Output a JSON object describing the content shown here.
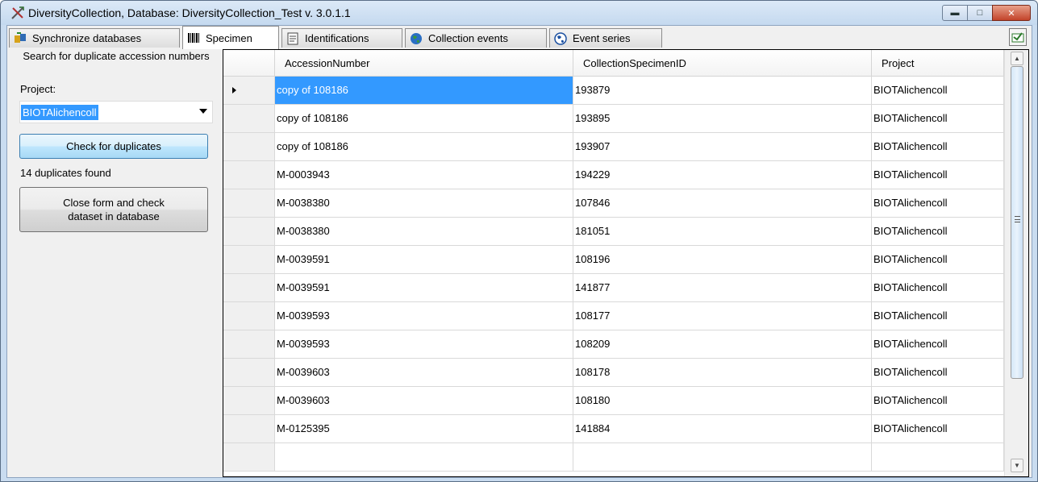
{
  "window": {
    "title": "DiversityCollection,  Database: DiversityCollection_Test   v. 3.0.1.1"
  },
  "tabs": [
    {
      "label": "Synchronize databases",
      "icon": "sync-databases-icon"
    },
    {
      "label": "Specimen",
      "icon": "barcode-icon",
      "active": true
    },
    {
      "label": "Identifications",
      "icon": "list-icon"
    },
    {
      "label": "Collection events",
      "icon": "globe-icon"
    },
    {
      "label": "Event series",
      "icon": "globe-series-icon"
    }
  ],
  "panel": {
    "search_title": "Search for duplicate accession numbers",
    "project_label": "Project:",
    "project_value": "BIOTAlichencoll",
    "check_button": "Check for duplicates",
    "result_text": "14 duplicates found",
    "close_button_line1": "Close form and check",
    "close_button_line2": "dataset in database"
  },
  "grid": {
    "columns": [
      "AccessionNumber",
      "CollectionSpecimenID",
      "Project"
    ],
    "rows": [
      [
        "copy of 108186",
        "193879",
        "BIOTAlichencoll"
      ],
      [
        "copy of 108186",
        "193895",
        "BIOTAlichencoll"
      ],
      [
        "copy of 108186",
        "193907",
        "BIOTAlichencoll"
      ],
      [
        "M-0003943",
        "194229",
        "BIOTAlichencoll"
      ],
      [
        "M-0038380",
        "107846",
        "BIOTAlichencoll"
      ],
      [
        "M-0038380",
        "181051",
        "BIOTAlichencoll"
      ],
      [
        "M-0039591",
        "108196",
        "BIOTAlichencoll"
      ],
      [
        "M-0039591",
        "141877",
        "BIOTAlichencoll"
      ],
      [
        "M-0039593",
        "108177",
        "BIOTAlichencoll"
      ],
      [
        "M-0039593",
        "108209",
        "BIOTAlichencoll"
      ],
      [
        "M-0039603",
        "108178",
        "BIOTAlichencoll"
      ],
      [
        "M-0039603",
        "108180",
        "BIOTAlichencoll"
      ],
      [
        "M-0125395",
        "141884",
        "BIOTAlichencoll"
      ],
      [
        "",
        "",
        ""
      ]
    ],
    "selected_row": 0
  },
  "colors": {
    "selection": "#3399ff",
    "title_bar": "#c4d9ef",
    "close_button": "#c2432a"
  }
}
